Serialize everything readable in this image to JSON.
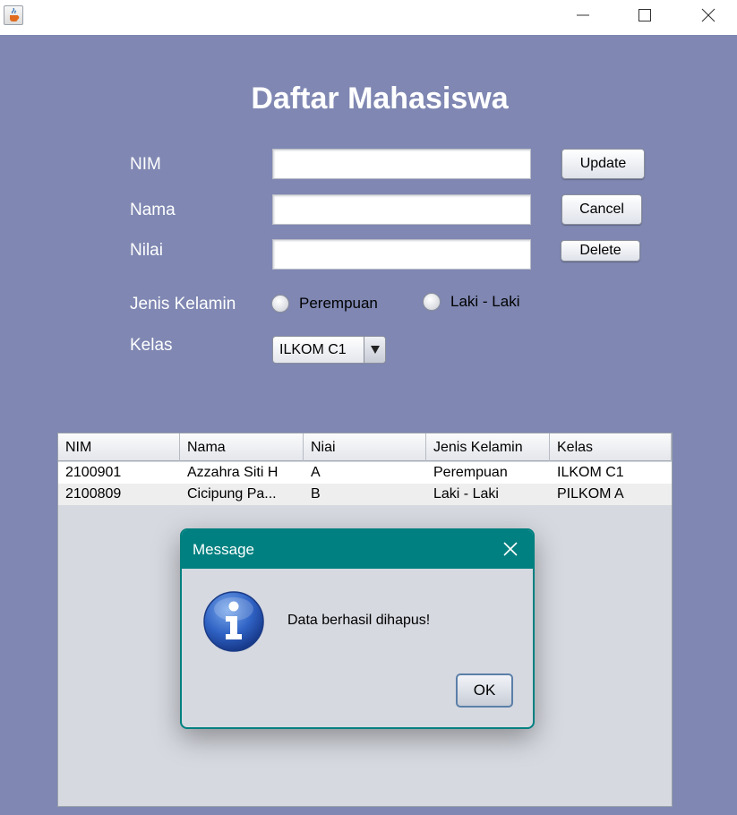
{
  "window": {
    "icon": "java-cup-icon",
    "controls": [
      "minimize-icon",
      "maximize-icon",
      "close-icon"
    ]
  },
  "form": {
    "title": "Daftar Mahasiswa",
    "labels": {
      "nim": "NIM",
      "nama": "Nama",
      "nilai": "Nilai",
      "jenis_kelamin": "Jenis Kelamin",
      "kelas": "Kelas"
    },
    "fields": {
      "nim": "",
      "nama": "",
      "nilai": ""
    },
    "buttons": {
      "update": "Update",
      "cancel": "Cancel",
      "delete": "Delete"
    },
    "gender_options": [
      "Perempuan",
      "Laki - Laki"
    ],
    "kelas_selected": "ILKOM C1"
  },
  "table": {
    "columns": [
      "NIM",
      "Nama",
      "Niai",
      "Jenis Kelamin",
      "Kelas"
    ],
    "rows": [
      [
        "2100901",
        "Azzahra Siti H",
        "A",
        "Perempuan",
        "ILKOM C1"
      ],
      [
        "2100809",
        "Cicipung Pa...",
        "B",
        "Laki - Laki",
        "PILKOM A"
      ]
    ]
  },
  "dialog": {
    "title": "Message",
    "message": "Data berhasil dihapus!",
    "ok_label": "OK",
    "icon": "info-icon"
  },
  "colors": {
    "background": "#7f87b2",
    "dialog_accent": "#008080",
    "table_bg": "#d6d9e0"
  }
}
